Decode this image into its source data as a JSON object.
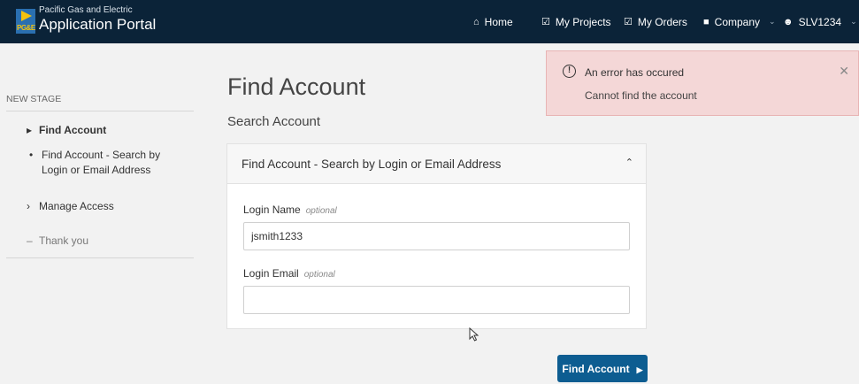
{
  "header": {
    "logo_text": "PG&E",
    "brand_sub": "Pacific Gas and Electric",
    "brand_main": "Application Portal",
    "nav": {
      "home": "Home",
      "projects": "My Projects",
      "orders": "My Orders",
      "company": "Company",
      "user": "SLV1234"
    }
  },
  "sidebar": {
    "heading": "NEW STAGE",
    "items": [
      {
        "label": "Find Account",
        "marker": "▸"
      },
      {
        "label": "Manage Access",
        "marker": "›"
      },
      {
        "label": "Thank you",
        "marker": "–"
      }
    ],
    "sub_items": [
      {
        "line1": "Find Account - Search by",
        "line2": "Login or Email Address"
      }
    ]
  },
  "main": {
    "title": "Find Account",
    "section": "Search Account",
    "panel": {
      "title": "Find Account - Search by Login or Email Address",
      "fields": [
        {
          "label": "Login Name",
          "hint": "optional",
          "value": "jsmith1233",
          "placeholder": ""
        },
        {
          "label": "Login Email",
          "hint": "optional",
          "value": "",
          "placeholder": ""
        }
      ]
    },
    "submit_label": "Find Account"
  },
  "alert": {
    "title": "An error has occured",
    "message": "Cannot find the account"
  },
  "colors": {
    "topbar": "#0b2338",
    "primary": "#0d5d91",
    "alert_bg": "#f4d7d7"
  }
}
